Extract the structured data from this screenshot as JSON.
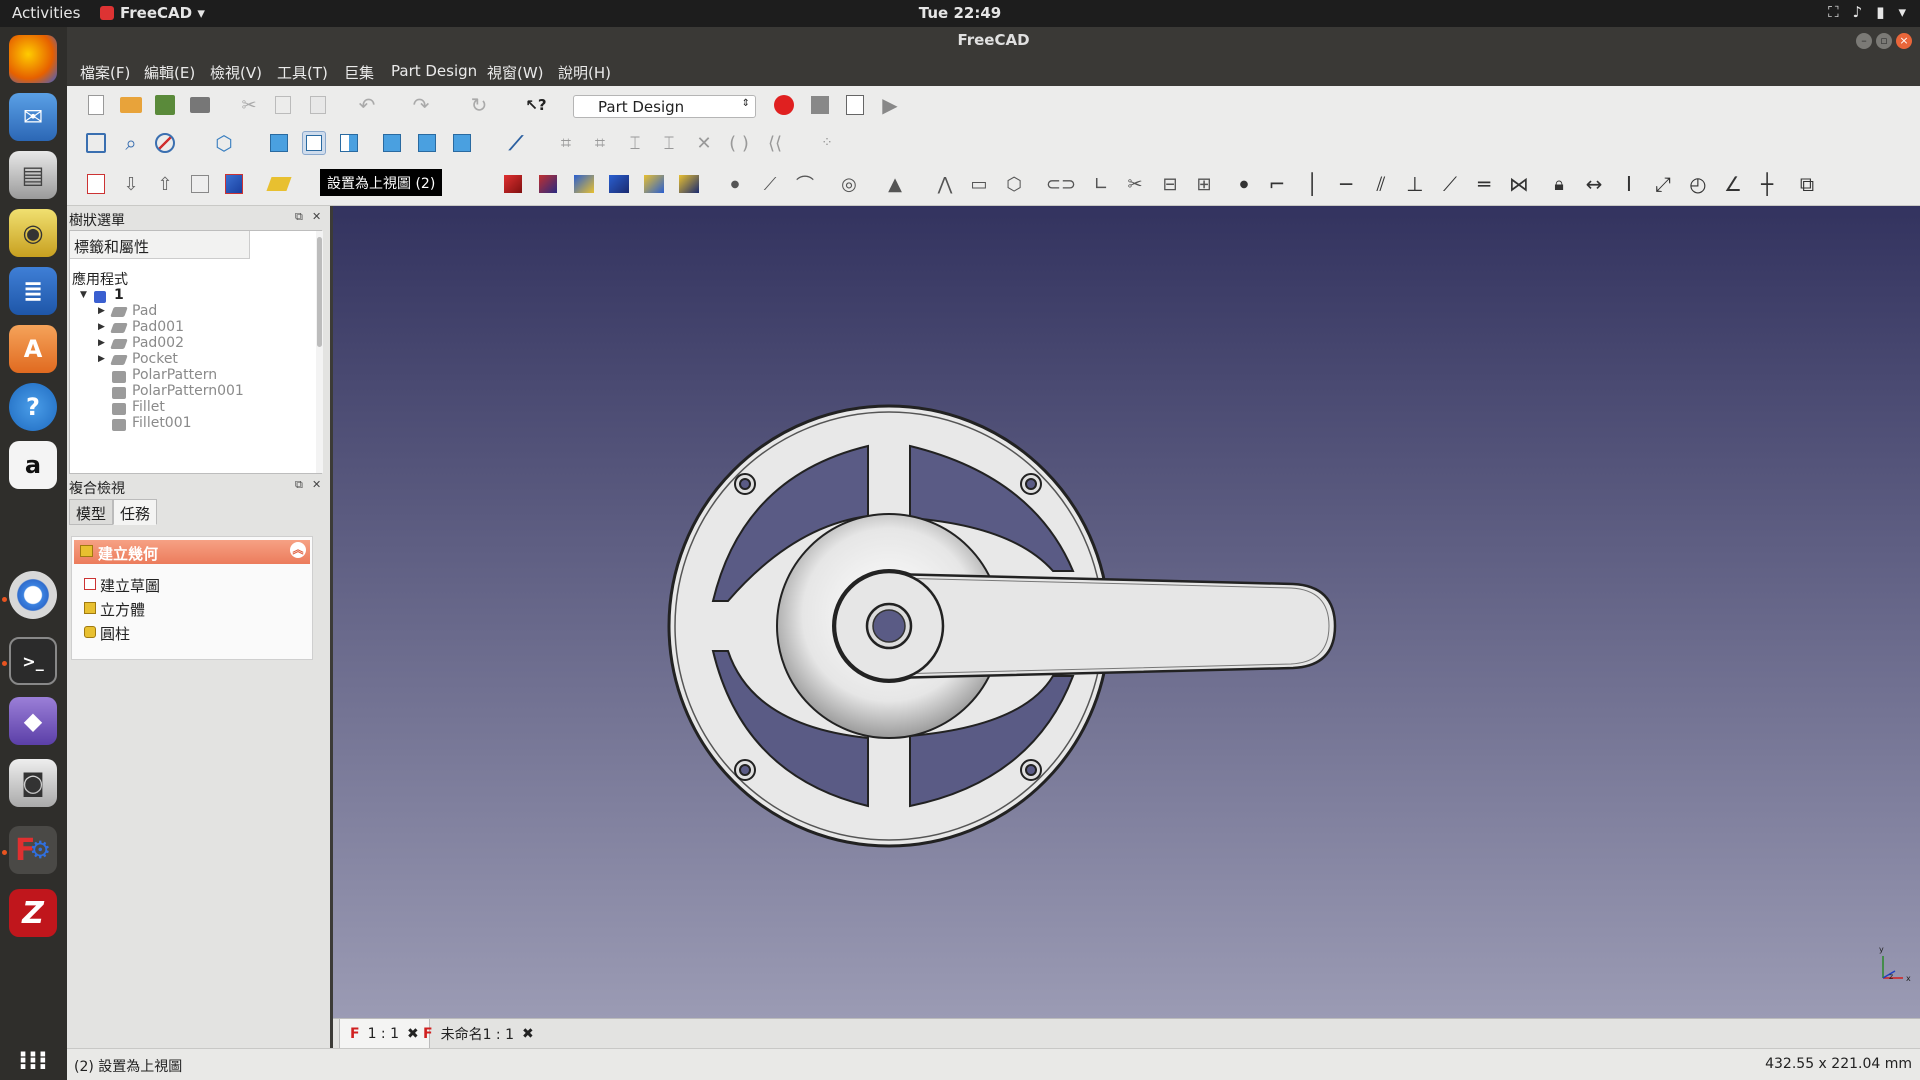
{
  "topbar": {
    "activities": "Activities",
    "app_name": "FreeCAD",
    "clock": "Tue 22:49"
  },
  "window": {
    "title": "FreeCAD"
  },
  "menu": [
    "檔案(F)",
    "編輯(E)",
    "檢視(V)",
    "工具(T)",
    "巨集",
    "Part Design",
    "視窗(W)",
    "說明(H)"
  ],
  "toolbar": {
    "workbench": "Part Design",
    "tooltip": "設置為上視圖 (2)"
  },
  "tree_panel": {
    "title": "樹狀選單",
    "header": "標籤和屬性",
    "section": "應用程式",
    "document": "1",
    "items": [
      "Pad",
      "Pad001",
      "Pad002",
      "Pocket",
      "PolarPattern",
      "PolarPattern001",
      "Fillet",
      "Fillet001"
    ]
  },
  "combo_panel": {
    "title": "複合檢視",
    "tabs": [
      "模型",
      "任務"
    ],
    "task_header": "建立幾何",
    "tasks": [
      "建立草圖",
      "立方體",
      "圓柱"
    ]
  },
  "doc_tabs": [
    "1 : 1",
    "未命名1 : 1"
  ],
  "status": {
    "left": "(2) 設置為上視圖",
    "right": "432.55 x 221.04 mm"
  },
  "axis": {
    "x": "x",
    "y": "y",
    "z": "z"
  },
  "colors": {
    "accent": "#e95420",
    "task_header": "#ec7c5c",
    "viewport_top": "#33335f",
    "viewport_bottom": "#9b9bb4"
  }
}
